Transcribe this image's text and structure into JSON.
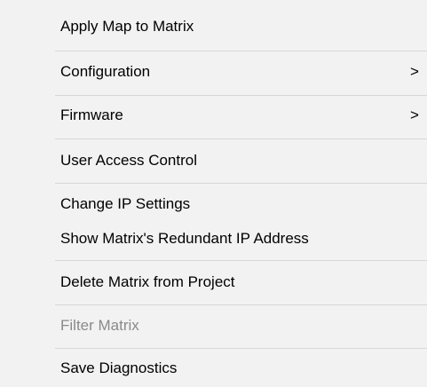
{
  "context_menu": {
    "items": [
      {
        "label": "Apply Map to Matrix"
      },
      {
        "label": "Configuration",
        "submenu_arrow": ">"
      },
      {
        "label": "Firmware",
        "submenu_arrow": ">"
      },
      {
        "label": "User Access Control"
      },
      {
        "label": "Change IP Settings"
      },
      {
        "label": "Show Matrix's Redundant IP Address"
      },
      {
        "label": "Delete Matrix from Project"
      },
      {
        "label": "Filter Matrix",
        "disabled": true
      },
      {
        "label": "Save Diagnostics"
      }
    ]
  },
  "colors": {
    "menu_background": "#f2f2f2",
    "separator": "#d7d7d7",
    "text": "#000000",
    "disabled_text": "#8a8a8a"
  }
}
